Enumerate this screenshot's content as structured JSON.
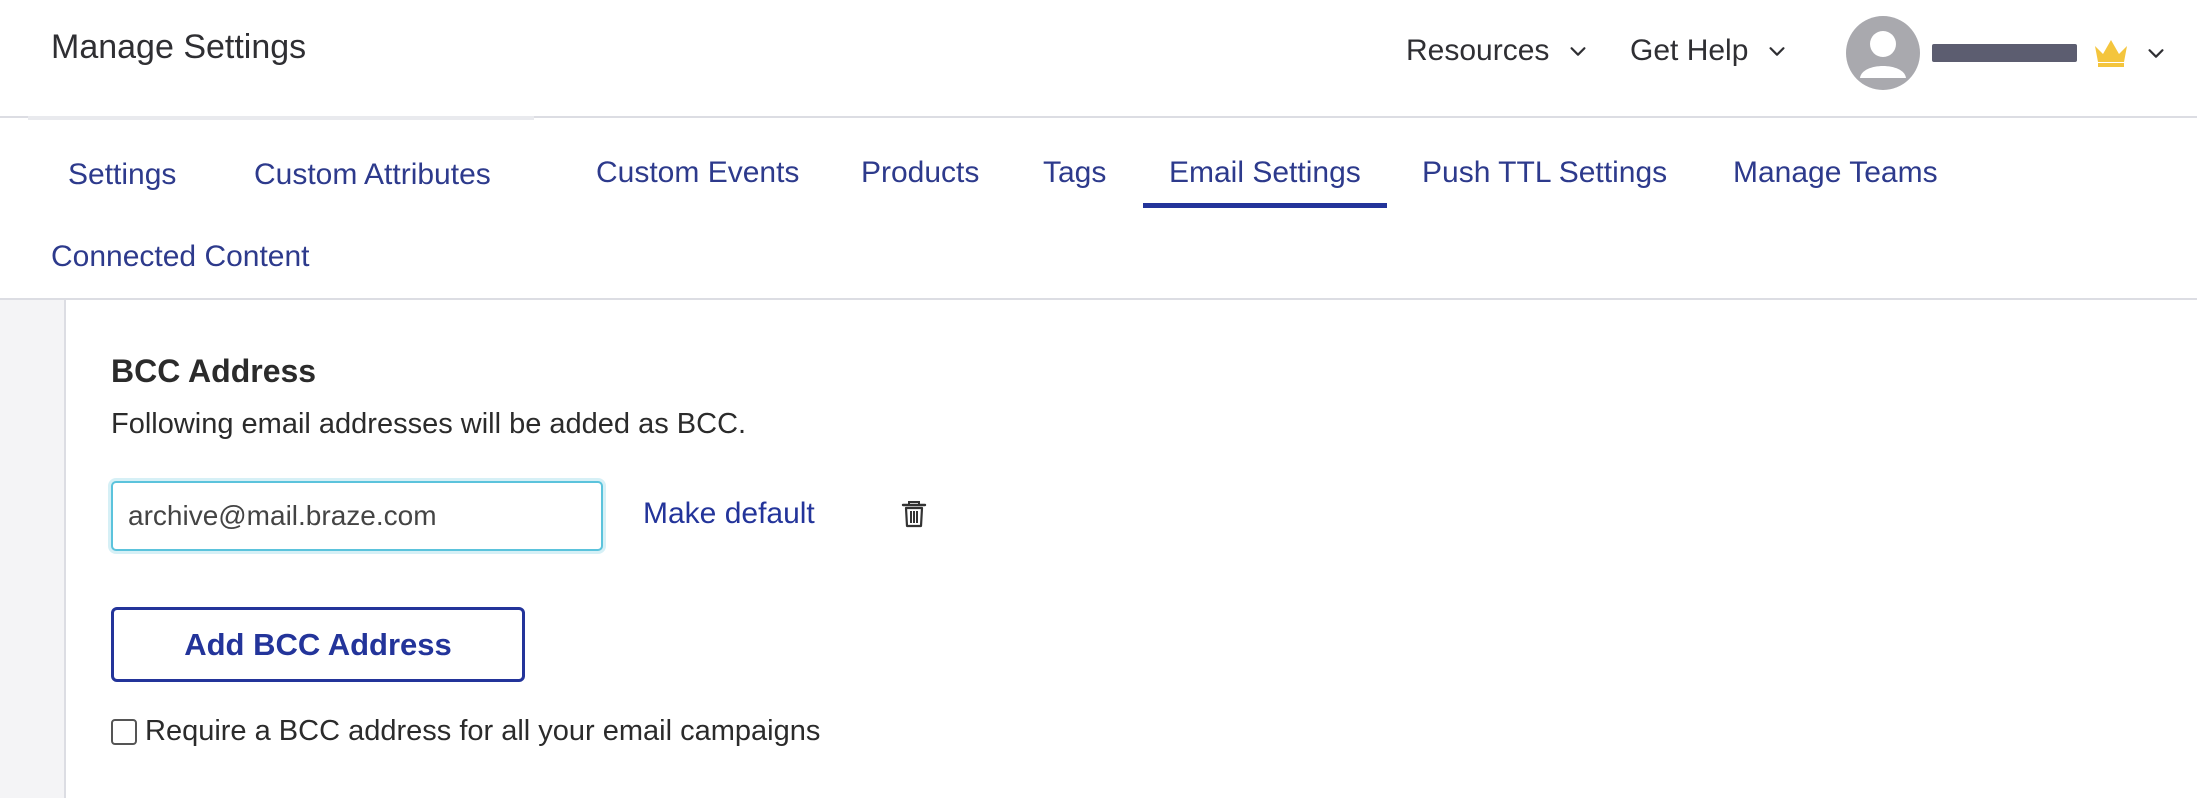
{
  "header": {
    "title": "Manage Settings",
    "menus": [
      {
        "label": "Resources",
        "icon": "chevron-down-icon"
      },
      {
        "label": "Get Help",
        "icon": "chevron-down-icon"
      }
    ],
    "user": {
      "avatar_icon": "user-avatar-icon",
      "badge_icon": "crown-icon",
      "badge_color": "#f4c53d",
      "menu_icon": "chevron-down-icon"
    }
  },
  "tabs": [
    {
      "label": "Settings"
    },
    {
      "label": "Custom Attributes"
    },
    {
      "label": "Custom Events"
    },
    {
      "label": "Products"
    },
    {
      "label": "Tags"
    },
    {
      "label": "Email Settings",
      "active": true
    },
    {
      "label": "Push TTL Settings"
    },
    {
      "label": "Manage Teams"
    },
    {
      "label": "Connected Content"
    }
  ],
  "bcc": {
    "title": "BCC Address",
    "description": "Following email addresses will be added as BCC.",
    "addresses": [
      {
        "value": "archive@mail.braze.com",
        "make_default_label": "Make default",
        "delete_icon": "trash-icon"
      }
    ],
    "add_button_label": "Add BCC Address",
    "require_label": "Require a BCC address for all your email campaigns",
    "require_checked": false
  },
  "colors": {
    "accent": "#23349a",
    "tab_text": "#2d3a8c",
    "input_focus": "#5bc3dc"
  }
}
